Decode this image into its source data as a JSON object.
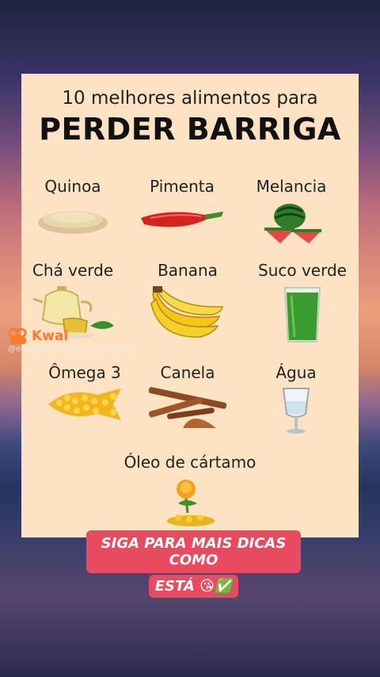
{
  "header": {
    "line1": "10 melhores alimentos para",
    "line2": "PERDER BARRIGA"
  },
  "foods": [
    {
      "label": "Quinoa",
      "icon": "quinoa-icon"
    },
    {
      "label": "Pimenta",
      "icon": "chili-pepper-icon"
    },
    {
      "label": "Melancia",
      "icon": "watermelon-icon"
    },
    {
      "label": "Chá verde",
      "icon": "green-tea-icon"
    },
    {
      "label": "Banana",
      "icon": "banana-icon"
    },
    {
      "label": "Suco verde",
      "icon": "green-juice-icon"
    },
    {
      "label": "Ômega 3",
      "icon": "omega3-capsules-icon"
    },
    {
      "label": "Canela",
      "icon": "cinnamon-icon"
    },
    {
      "label": "Água",
      "icon": "water-glass-icon"
    },
    {
      "label": "Óleo de cártamo",
      "icon": "safflower-icon"
    }
  ],
  "watermark": {
    "brand": "Kwai",
    "user": "@emagrecer_em_casa_meninas"
  },
  "cta": {
    "line1": "SIGA PARA MAIS DICAS COMO",
    "line2": "ESTÁ",
    "emojis": "😘✅"
  }
}
